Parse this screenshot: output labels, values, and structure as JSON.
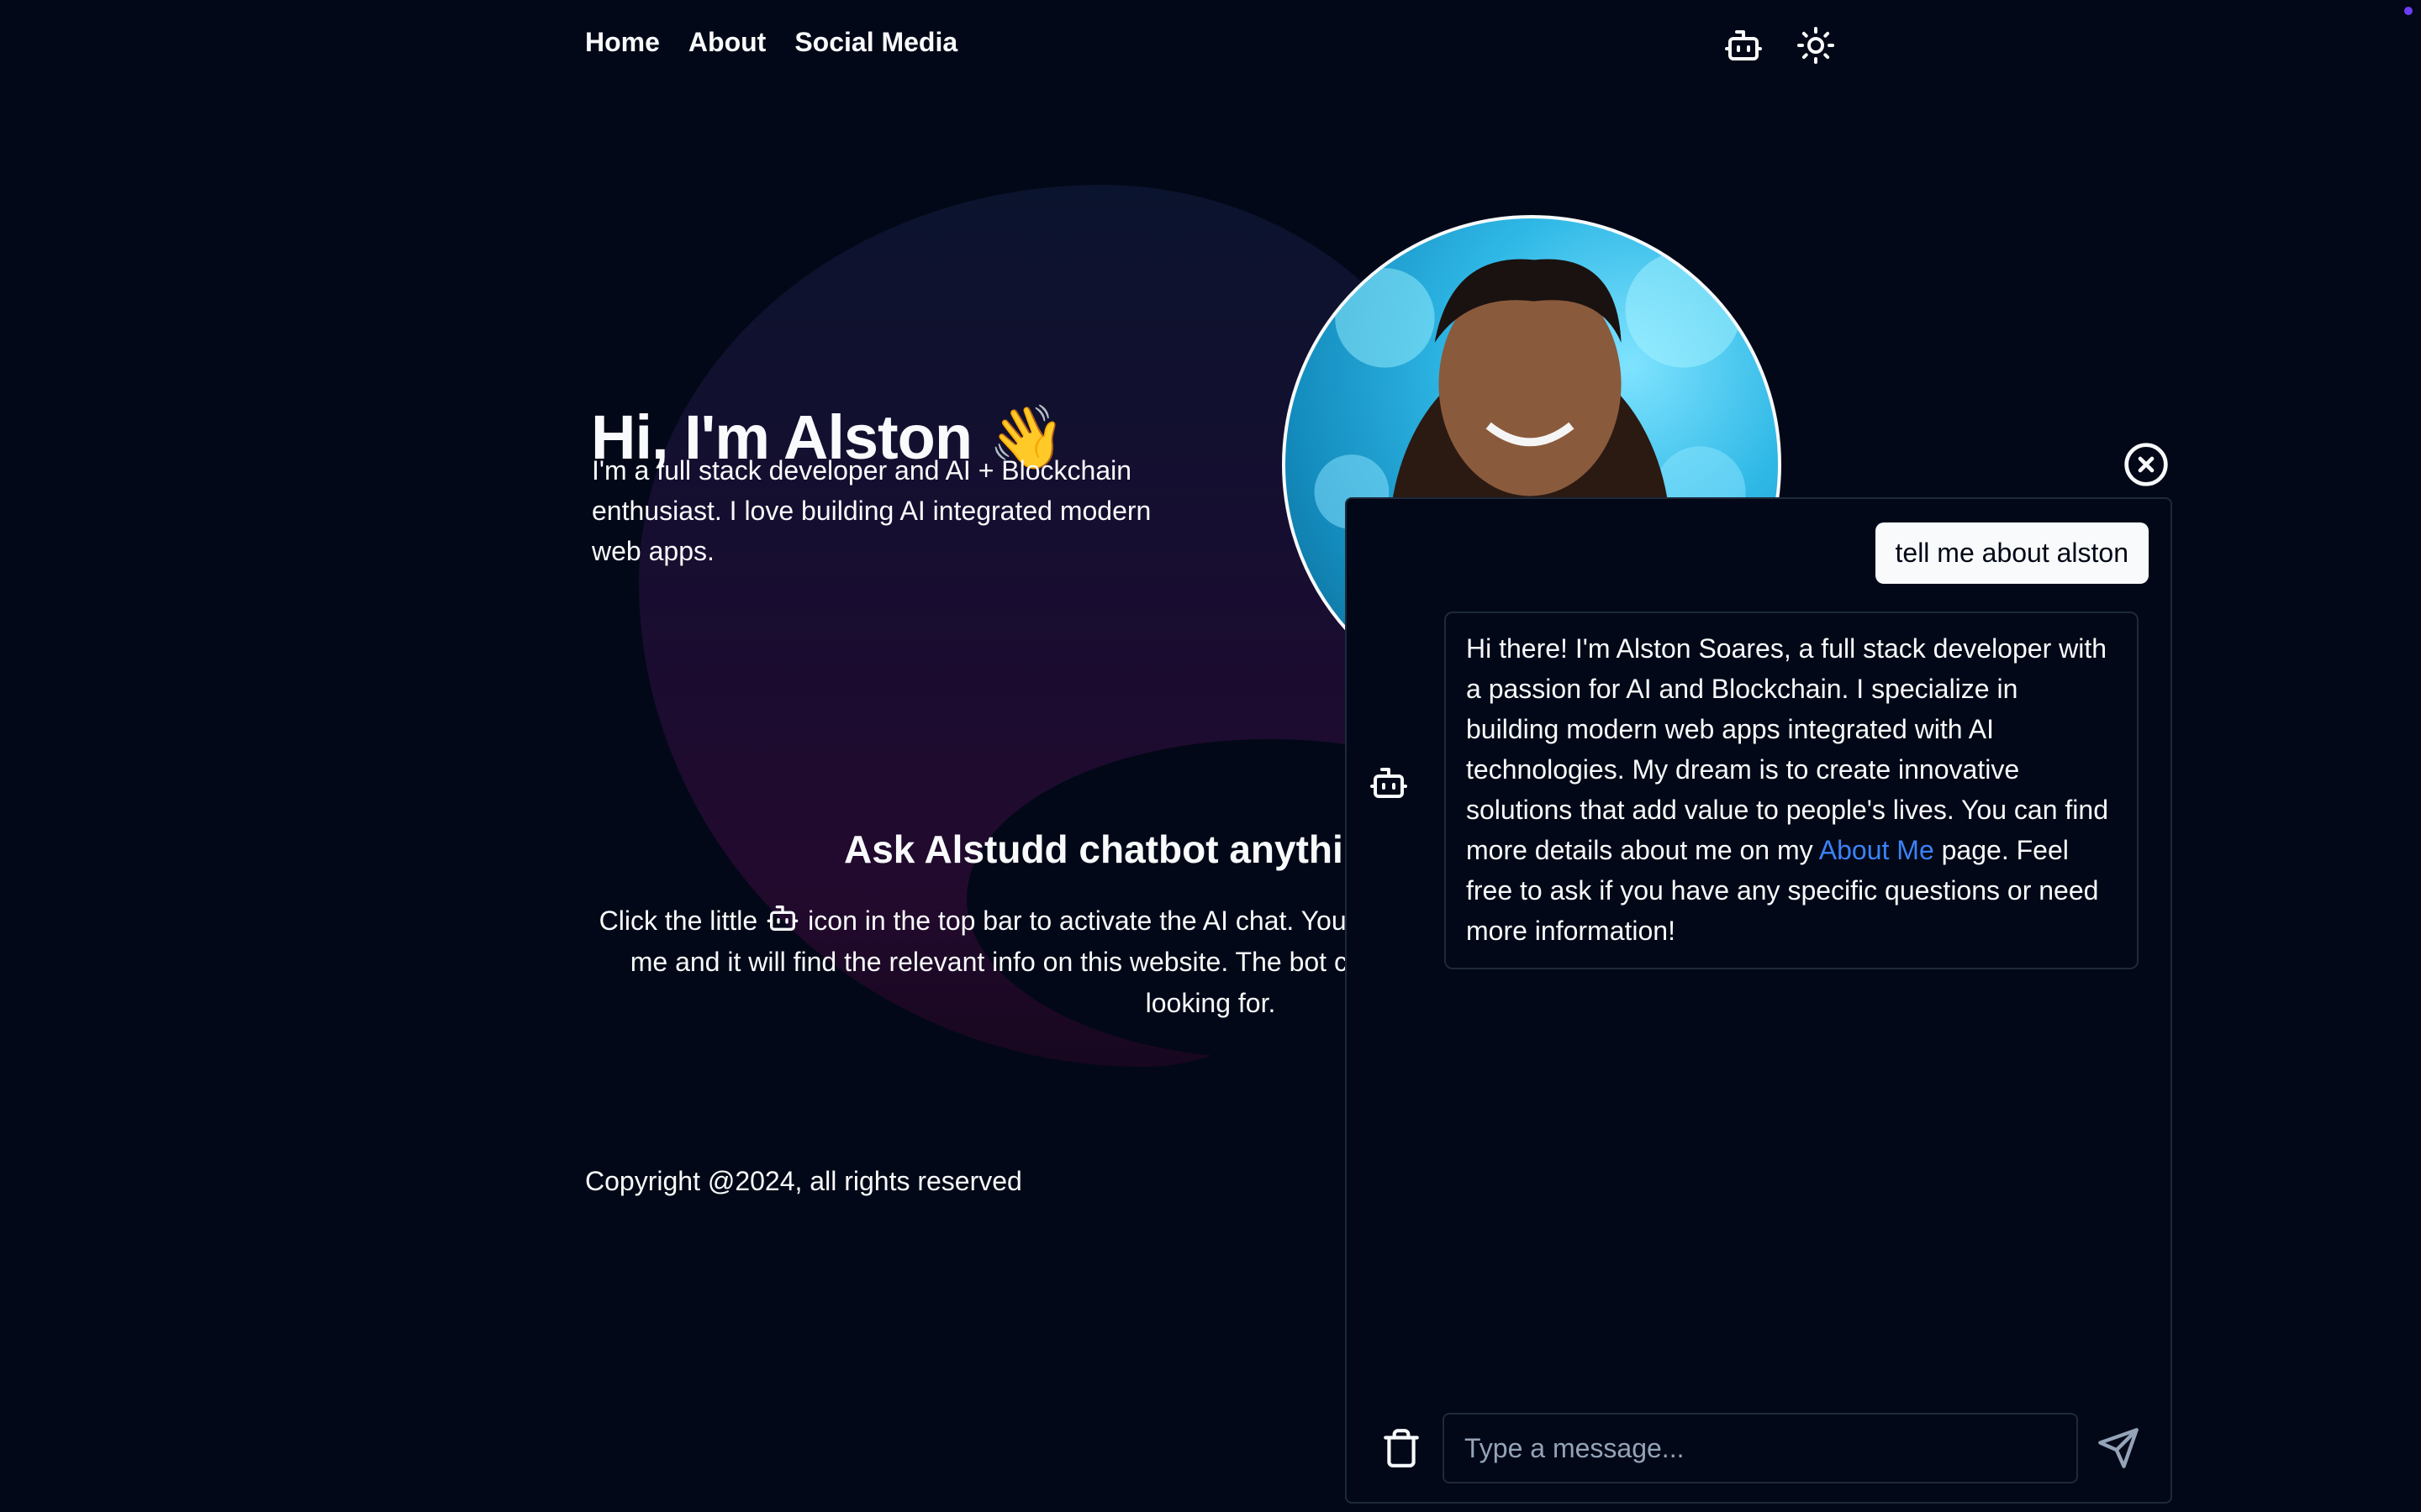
{
  "nav": {
    "links": [
      "Home",
      "About",
      "Social Media"
    ],
    "icons": [
      "bot-icon",
      "sun-icon"
    ]
  },
  "hero": {
    "title": "Hi, I'm Alston 👋",
    "subtitle": "I'm a full stack developer and AI + Blockchain enthusiast. I love building AI integrated modern web apps."
  },
  "ask": {
    "heading": "Ask Alstudd chatbot anything",
    "text_before": "Click the little",
    "text_after": "icon in the top bar to activate the AI chat. You can ask the chatbot any question about me and it will find the relevant info on this website. The bot can even provide links to pages you're looking for."
  },
  "footer": {
    "copyright": "Copyright @2024, all rights reserved"
  },
  "chat": {
    "user_message": "tell me about alston",
    "bot_message_before": "Hi there! I'm Alston Soares, a full stack developer with a passion for AI and Blockchain. I specialize in building modern web apps integrated with AI technologies. My dream is to create innovative solutions that add value to people's lives. You can find more details about me on my",
    "bot_link": "About Me",
    "bot_message_after": "page. Feel free to ask if you have any specific questions or need more information!",
    "input_placeholder": "Type a message...",
    "icons": [
      "close-icon",
      "bot-icon",
      "trash-icon",
      "send-icon"
    ]
  },
  "colors": {
    "background": "#020817",
    "foreground": "#f8fafc",
    "border": "#1e293b",
    "link": "#3b82f6"
  }
}
